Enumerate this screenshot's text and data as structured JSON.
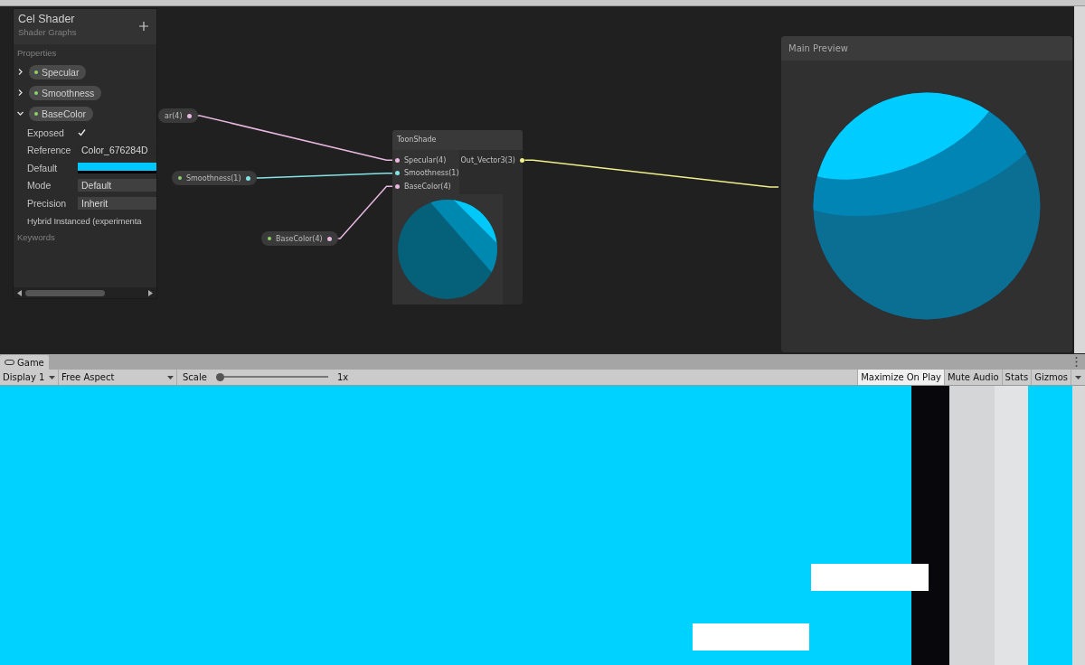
{
  "blackboard": {
    "title": "Cel Shader",
    "subtitle": "Shader Graphs",
    "section": "Properties",
    "keywords": "Keywords",
    "properties": [
      {
        "name": "Specular",
        "expanded": false
      },
      {
        "name": "Smoothness",
        "expanded": false
      },
      {
        "name": "BaseColor",
        "expanded": true,
        "fields": [
          {
            "kind": "checkbox",
            "label": "Exposed",
            "checked": true
          },
          {
            "kind": "text",
            "label": "Reference",
            "value": "Color_676284D"
          },
          {
            "kind": "color",
            "label": "Default",
            "color": "#00c8ff"
          },
          {
            "kind": "dropdown",
            "label": "Mode",
            "value": "Default"
          },
          {
            "kind": "dropdown",
            "label": "Precision",
            "value": "Inherit"
          },
          {
            "kind": "label",
            "label": "Hybrid Instanced (experimenta"
          }
        ]
      }
    ]
  },
  "graph": {
    "property_nodes": [
      {
        "label": "ar(4)",
        "color": "#e8b8e0"
      },
      {
        "label": "Smoothness(1)",
        "color": "#84e4e7"
      },
      {
        "label": "BaseColor(4)",
        "color": "#e8b8e0"
      }
    ],
    "toon_node": {
      "title": "ToonShade",
      "inputs": [
        {
          "label": "Specular(4)",
          "color": "#e8b8e0"
        },
        {
          "label": "Smoothness(1)",
          "color": "#84e4e7"
        },
        {
          "label": "BaseColor(4)",
          "color": "#e8b8e0"
        }
      ],
      "output": {
        "label": "Out_Vector3(3)",
        "color": "#f0f08c"
      }
    },
    "main_preview": {
      "title": "Main Preview"
    }
  },
  "game": {
    "tab": "Game",
    "display": "Display 1",
    "aspect": "Free Aspect",
    "scale_label": "Scale",
    "scale": {
      "level": 0
    },
    "scale_reading": "1x",
    "toggles": [
      {
        "label": "Maximize On Play",
        "on": true
      },
      {
        "label": "Mute Audio",
        "on": false
      },
      {
        "label": "Stats",
        "on": false
      },
      {
        "label": "Gizmos",
        "on": false
      }
    ]
  }
}
